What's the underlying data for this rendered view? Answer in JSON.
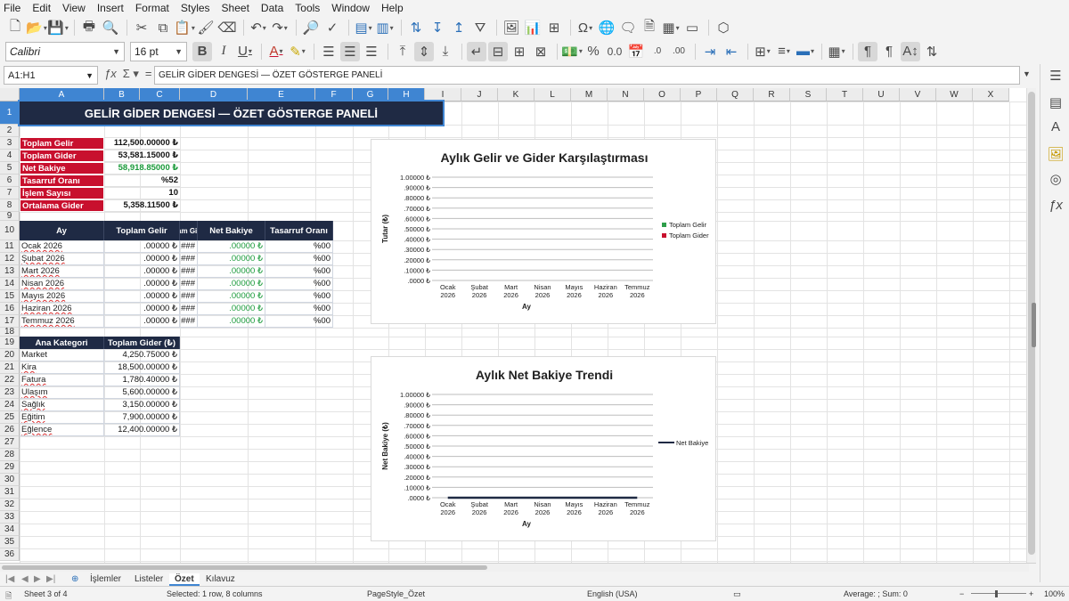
{
  "menu": [
    "File",
    "Edit",
    "View",
    "Insert",
    "Format",
    "Styles",
    "Sheet",
    "Data",
    "Tools",
    "Window",
    "Help"
  ],
  "font": {
    "name": "Calibri",
    "size": "16 pt"
  },
  "namebox": "A1:H1",
  "formula": "GELİR GİDER DENGESİ — ÖZET GÖSTERGE PANELİ",
  "columns": [
    "A",
    "B",
    "C",
    "D",
    "E",
    "F",
    "G",
    "H",
    "I",
    "J",
    "K",
    "L",
    "M",
    "N",
    "O",
    "P",
    "Q",
    "R",
    "S",
    "T",
    "U",
    "V",
    "W",
    "X"
  ],
  "rows": [
    "1",
    "2",
    "3",
    "4",
    "5",
    "6",
    "7",
    "8",
    "9",
    "10",
    "11",
    "12",
    "13",
    "14",
    "15",
    "16",
    "17",
    "18",
    "19",
    "20",
    "21",
    "22",
    "23",
    "24",
    "25",
    "26",
    "27",
    "28",
    "29",
    "30",
    "31",
    "32",
    "33",
    "34",
    "35",
    "36"
  ],
  "title": "GELİR GİDER DENGESİ — ÖZET GÖSTERGE PANELİ",
  "summary": [
    {
      "label": "Toplam Gelir",
      "value": "112,500.00000 ₺",
      "cls": ""
    },
    {
      "label": "Toplam Gider",
      "value": "53,581.15000 ₺",
      "cls": ""
    },
    {
      "label": "Net Bakiye",
      "value": "58,918.85000 ₺",
      "cls": "green"
    },
    {
      "label": "Tasarruf Oranı",
      "value": "%52",
      "cls": ""
    },
    {
      "label": "İşlem Sayısı",
      "value": "10",
      "cls": ""
    },
    {
      "label": "Ortalama Gider",
      "value": "5,358.11500 ₺",
      "cls": ""
    }
  ],
  "monthly": {
    "headers": [
      "Ay",
      "Toplam Gelir",
      "lam Gid",
      "Net Bakiye",
      "Tasarruf Oranı"
    ],
    "rows": [
      [
        "Ocak 2026",
        ".00000 ₺",
        "###",
        ".00000 ₺",
        "%00"
      ],
      [
        "Şubat 2026",
        ".00000 ₺",
        "###",
        ".00000 ₺",
        "%00"
      ],
      [
        "Mart 2026",
        ".00000 ₺",
        "###",
        ".00000 ₺",
        "%00"
      ],
      [
        "Nisan 2026",
        ".00000 ₺",
        "###",
        ".00000 ₺",
        "%00"
      ],
      [
        "Mayıs 2026",
        ".00000 ₺",
        "###",
        ".00000 ₺",
        "%00"
      ],
      [
        "Haziran 2026",
        ".00000 ₺",
        "###",
        ".00000 ₺",
        "%00"
      ],
      [
        "Temmuz 2026",
        ".00000 ₺",
        "###",
        ".00000 ₺",
        "%00"
      ]
    ]
  },
  "categories": {
    "headers": [
      "Ana Kategori",
      "Toplam Gider (₺)"
    ],
    "rows": [
      [
        "Market",
        "4,250.75000 ₺"
      ],
      [
        "Kira",
        "18,500.00000 ₺"
      ],
      [
        "Fatura",
        "1,780.40000 ₺"
      ],
      [
        "Ulaşım",
        "5,600.00000 ₺"
      ],
      [
        "Sağlık",
        "3,150.00000 ₺"
      ],
      [
        "Eğitim",
        "7,900.00000 ₺"
      ],
      [
        "Eğlence",
        "12,400.00000 ₺"
      ]
    ]
  },
  "chart_data": [
    {
      "type": "bar",
      "title": "Aylık Gelir ve Gider Karşılaştırması",
      "xlabel": "Ay",
      "ylabel": "Tutar (₺)",
      "categories": [
        "Ocak 2026",
        "Şubat 2026",
        "Mart 2026",
        "Nisan 2026",
        "Mayıs 2026",
        "Haziran 2026",
        "Temmuz 2026"
      ],
      "yticks": [
        ".0000 ₺",
        ".10000 ₺",
        ".20000 ₺",
        ".30000 ₺",
        ".40000 ₺",
        ".50000 ₺",
        ".60000 ₺",
        ".70000 ₺",
        ".80000 ₺",
        ".90000 ₺",
        "1.00000 ₺"
      ],
      "ylim": [
        0,
        1
      ],
      "legend_position": "right",
      "series": [
        {
          "name": "Toplam Gelir",
          "color": "#2e9e4a",
          "values": [
            0,
            0,
            0,
            0,
            0,
            0,
            0
          ]
        },
        {
          "name": "Toplam Gider",
          "color": "#c8102e",
          "values": [
            0,
            0,
            0,
            0,
            0,
            0,
            0
          ]
        }
      ]
    },
    {
      "type": "line",
      "title": "Aylık Net Bakiye Trendi",
      "xlabel": "Ay",
      "ylabel": "Net Bakiye (₺)",
      "categories": [
        "Ocak 2026",
        "Şubat 2026",
        "Mart 2026",
        "Nisan 2026",
        "Mayıs 2026",
        "Haziran 2026",
        "Temmuz 2026"
      ],
      "yticks": [
        ".0000 ₺",
        ".10000 ₺",
        ".20000 ₺",
        ".30000 ₺",
        ".40000 ₺",
        ".50000 ₺",
        ".60000 ₺",
        ".70000 ₺",
        ".80000 ₺",
        ".90000 ₺",
        "1.00000 ₺"
      ],
      "ylim": [
        0,
        1
      ],
      "legend_position": "right",
      "series": [
        {
          "name": "Net Bakiye",
          "color": "#1f2a44",
          "values": [
            0,
            0,
            0,
            0,
            0,
            0,
            0
          ]
        }
      ]
    }
  ],
  "tabs": [
    "İşlemler",
    "Listeler",
    "Özet",
    "Kılavuz"
  ],
  "active_tab": "Özet",
  "status": {
    "sheet": "Sheet 3 of 4",
    "selection": "Selected: 1 row, 8 columns",
    "pagestyle": "PageStyle_Özet",
    "language": "English (USA)",
    "sum": "Average: ; Sum: 0",
    "zoom": "100%"
  }
}
